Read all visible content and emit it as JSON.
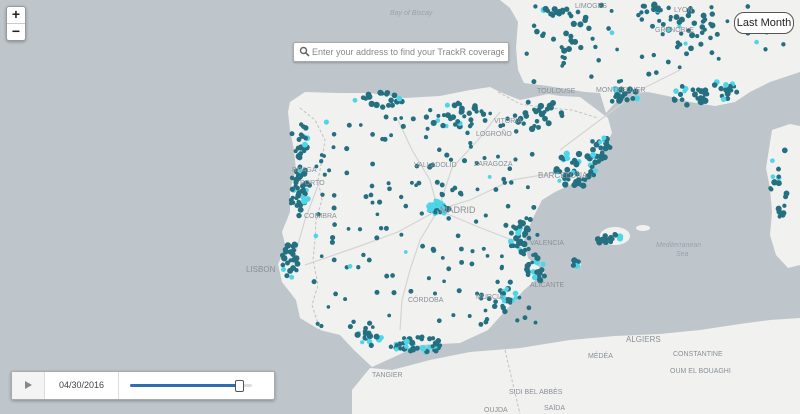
{
  "map": {
    "labels": {
      "sea": [
        "Bay of Biscay",
        "Mediterranean",
        "Sea"
      ],
      "cities": [
        "LIMOGES",
        "LYON",
        "GRENOBLE",
        "TOULOUSE",
        "MONTPELLIER",
        "VITORIA",
        "LOGROÑO",
        "ZARAGOZA",
        "VALLADOLID",
        "MADRID",
        "BARCELONA",
        "BRAGA",
        "PORTO",
        "COIMBRA",
        "LISBON",
        "VALENCIA",
        "ALICANTE",
        "CÓRDOBA",
        "MURCIA",
        "TANGIER",
        "ALGIERS",
        "MÉDÉA",
        "CONSTANTINE",
        "OUM EL BOUAGHI",
        "SIDI BEL ABBÈS",
        "SAÏDA",
        "OUJDA"
      ]
    },
    "colors": {
      "water": "#bfc6cb",
      "land": "#f1f1f0",
      "border": "#c2c2c2",
      "road": "#d4d4d4",
      "dot": "#246f80",
      "dot_hot": "#4fd5e8",
      "label": "#8a9097",
      "sea_label": "#9aa3ab"
    }
  },
  "controls": {
    "zoom_in": "+",
    "zoom_out": "−",
    "period_button": "Last Month",
    "search_placeholder": "Enter your address to find your TrackR coverage"
  },
  "timeline": {
    "play_icon": "play-icon",
    "date": "04/30/2016",
    "progress": 0.89
  }
}
